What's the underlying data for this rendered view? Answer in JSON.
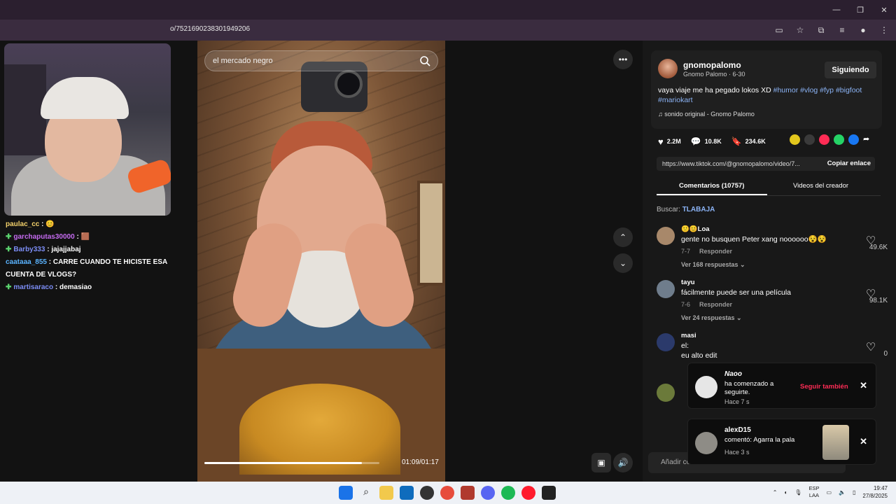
{
  "browser": {
    "url": "o/7521690238301949206"
  },
  "stream": {
    "chat": [
      {
        "user": "paulac_cc",
        "sep": " : ",
        "msg": "😊",
        "user_color": "#f3d16b",
        "badge": ""
      },
      {
        "user": "garchaputas30000",
        "sep": " : ",
        "msg": "🟫",
        "user_color": "#c56bf0",
        "badge": "✚"
      },
      {
        "user": "Barby333",
        "sep": " : ",
        "msg": "jajajjabaj",
        "user_color": "#7c8df5",
        "badge": "✚"
      },
      {
        "user": "caataaa_855",
        "sep": " : ",
        "msg": "CARRE CUANDO TE HICISTE ESA CUENTA DE VLOGS?",
        "user_color": "#5ab3ff",
        "badge": ""
      },
      {
        "user": "martisaraco",
        "sep": " : ",
        "msg": "demasiao",
        "user_color": "#7c8df5",
        "badge": "✚"
      }
    ]
  },
  "video": {
    "search_placeholder": "el mercado negro",
    "time": "01:09/01:17",
    "progress_fraction": 0.9
  },
  "creator": {
    "username": "gnomopalomo",
    "display": "Gnomo Palomo · 6-30",
    "follow_label": "Siguiendo",
    "caption_text": "vaya viaje me ha pegado lokos XD ",
    "hashtags": [
      "#humor",
      "#vlog",
      "#fyp",
      "#bigfoot",
      "#mariokart"
    ],
    "sound": "sonido original - Gnomo Palomo"
  },
  "stats": {
    "likes": "2.2M",
    "comments": "10.8K",
    "saves": "234.6K"
  },
  "link": {
    "url": "https://www.tiktok.com/@gnomopalomo/video/7...",
    "copy_label": "Copiar enlace"
  },
  "tabs": {
    "comments": "Comentarios (10757)",
    "creator_videos": "Videos del creador"
  },
  "search_comments": {
    "label": "Buscar: ",
    "term": "TLABAJA"
  },
  "comments": [
    {
      "user": "🙂😊Loa",
      "text": "gente no busquen Peter xang noooooo😵😵",
      "date": "7-7",
      "reply": "Responder",
      "replies": "Ver 168 respuestas ⌄",
      "likes": "49.6K"
    },
    {
      "user": "tayu",
      "text": "fácilmente puede ser una película",
      "date": "7-6",
      "reply": "Responder",
      "replies": "Ver 24 respuestas ⌄",
      "likes": "98.1K"
    },
    {
      "user": "masi",
      "text": "el:\neu alto edit",
      "date": "",
      "reply": "",
      "replies": "",
      "likes": "0"
    }
  ],
  "add_comment_placeholder": "Añadir co",
  "notifications": [
    {
      "title": "Naoo",
      "body": "ha comenzado a seguirte.",
      "time": "Hace 7 s",
      "action": "Seguir también"
    },
    {
      "title": "alexD15",
      "body": "comentó: Agarra la pala",
      "time": "Hace 3 s",
      "action": ""
    }
  ],
  "taskbar": {
    "lang1": "ESP",
    "lang2": "LAA",
    "time": "19:47",
    "date": "27/8/2025"
  }
}
